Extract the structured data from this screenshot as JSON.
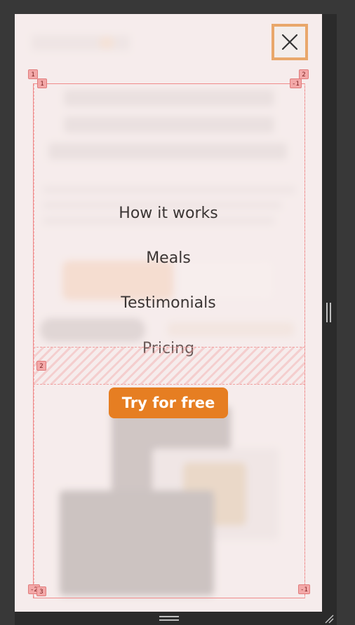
{
  "close_button": {
    "icon": "close-icon",
    "accent": "#e9a76b"
  },
  "menu": {
    "items": [
      {
        "label": "How it works"
      },
      {
        "label": "Meals"
      },
      {
        "label": "Testimonials"
      },
      {
        "label": "Pricing"
      }
    ],
    "cta_label": "Try for free",
    "cta_color": "#e67e22"
  },
  "grid_overlay": {
    "tags": {
      "top_left_outer": "1",
      "top_left_inner": "1",
      "top_right_inner": "-1",
      "top_right_outer": "2",
      "row_gap": "2",
      "bottom_left_outer": "-2",
      "bottom_left_inner": "3",
      "bottom_right": "-1"
    },
    "color": "#ef8b8b"
  }
}
